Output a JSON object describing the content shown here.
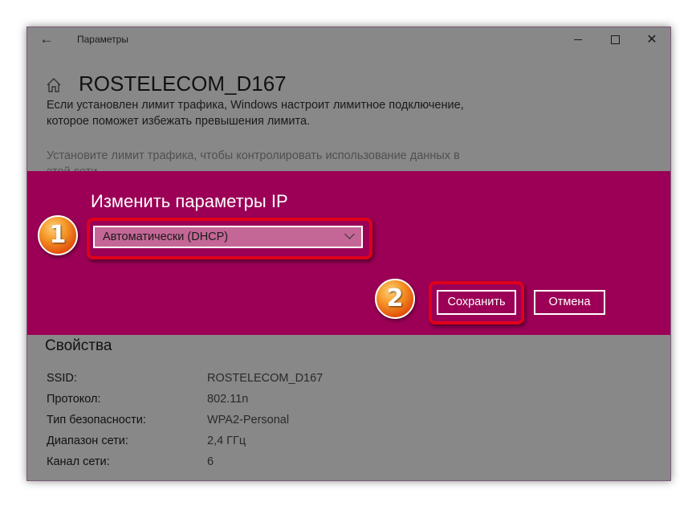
{
  "window": {
    "app_title": "Параметры",
    "page_title": "ROSTELECOM_D167",
    "icons": {
      "back": "arrow-left-icon",
      "home": "home-icon",
      "minimize": "minimize-icon",
      "maximize": "maximize-icon",
      "close": "close-icon"
    }
  },
  "description": {
    "paragraph1": "Если установлен лимит трафика, Windows настроит лимитное подключение, которое поможет избежать превышения лимита.",
    "paragraph2": "Установите лимит трафика, чтобы контролировать использование данных в этой сети"
  },
  "dialog": {
    "title": "Изменить параметры IP",
    "select_value": "Автоматически (DHCP)",
    "save_label": "Сохранить",
    "cancel_label": "Отмена",
    "colors": {
      "overlay": "#9b0056",
      "select": "#c46796",
      "highlight": "#e0001b"
    }
  },
  "annotations": {
    "badge1": "1",
    "badge2": "2"
  },
  "properties": {
    "title": "Свойства",
    "rows": [
      {
        "label": "SSID:",
        "value": "ROSTELECOM_D167"
      },
      {
        "label": "Протокол:",
        "value": "802.11n"
      },
      {
        "label": "Тип безопасности:",
        "value": "WPA2-Personal"
      },
      {
        "label": "Диапазон сети:",
        "value": "2,4 ГГц"
      },
      {
        "label": "Канал сети:",
        "value": "6"
      }
    ]
  }
}
